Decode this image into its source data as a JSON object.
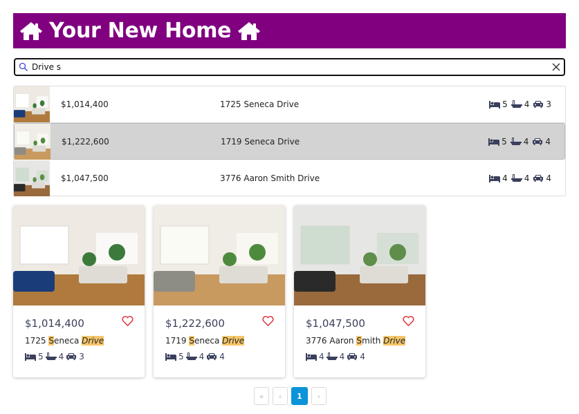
{
  "header": {
    "title": "Your New Home",
    "bg_color": "#800080"
  },
  "search": {
    "value": "Drive s",
    "icon": "search-icon",
    "clear_icon": "close-icon"
  },
  "results": [
    {
      "price": "$1,014,400",
      "address": "1725 Seneca Drive",
      "beds": "5",
      "baths": "4",
      "cars": "3",
      "selected": false
    },
    {
      "price": "$1,222,600",
      "address": "1719 Seneca Drive",
      "beds": "5",
      "baths": "4",
      "cars": "4",
      "selected": true
    },
    {
      "price": "$1,047,500",
      "address": "3776 Aaron Smith Drive",
      "beds": "4",
      "baths": "4",
      "cars": "4",
      "selected": false
    }
  ],
  "cards": [
    {
      "price": "$1,014,400",
      "addr_num": "1725",
      "addr_hl": "S",
      "addr_rest": "eneca",
      "addr_drive": "Drive",
      "beds": "5",
      "baths": "4",
      "cars": "3"
    },
    {
      "price": "$1,222,600",
      "addr_num": "1719",
      "addr_hl": "S",
      "addr_rest": "eneca",
      "addr_drive": "Drive",
      "beds": "5",
      "baths": "4",
      "cars": "4"
    },
    {
      "price": "$1,047,500",
      "addr_num": "3776 Aaron",
      "addr_hl": "S",
      "addr_rest": "mith",
      "addr_drive": "Drive",
      "beds": "4",
      "baths": "4",
      "cars": "4"
    }
  ],
  "pagination": {
    "first": "«",
    "prev": "‹",
    "current": "1",
    "next": "›"
  },
  "colors": {
    "accent": "#0b94d9",
    "highlight": "#f5c56b",
    "heart": "#e0323c",
    "icon": "#3a3f5c"
  }
}
